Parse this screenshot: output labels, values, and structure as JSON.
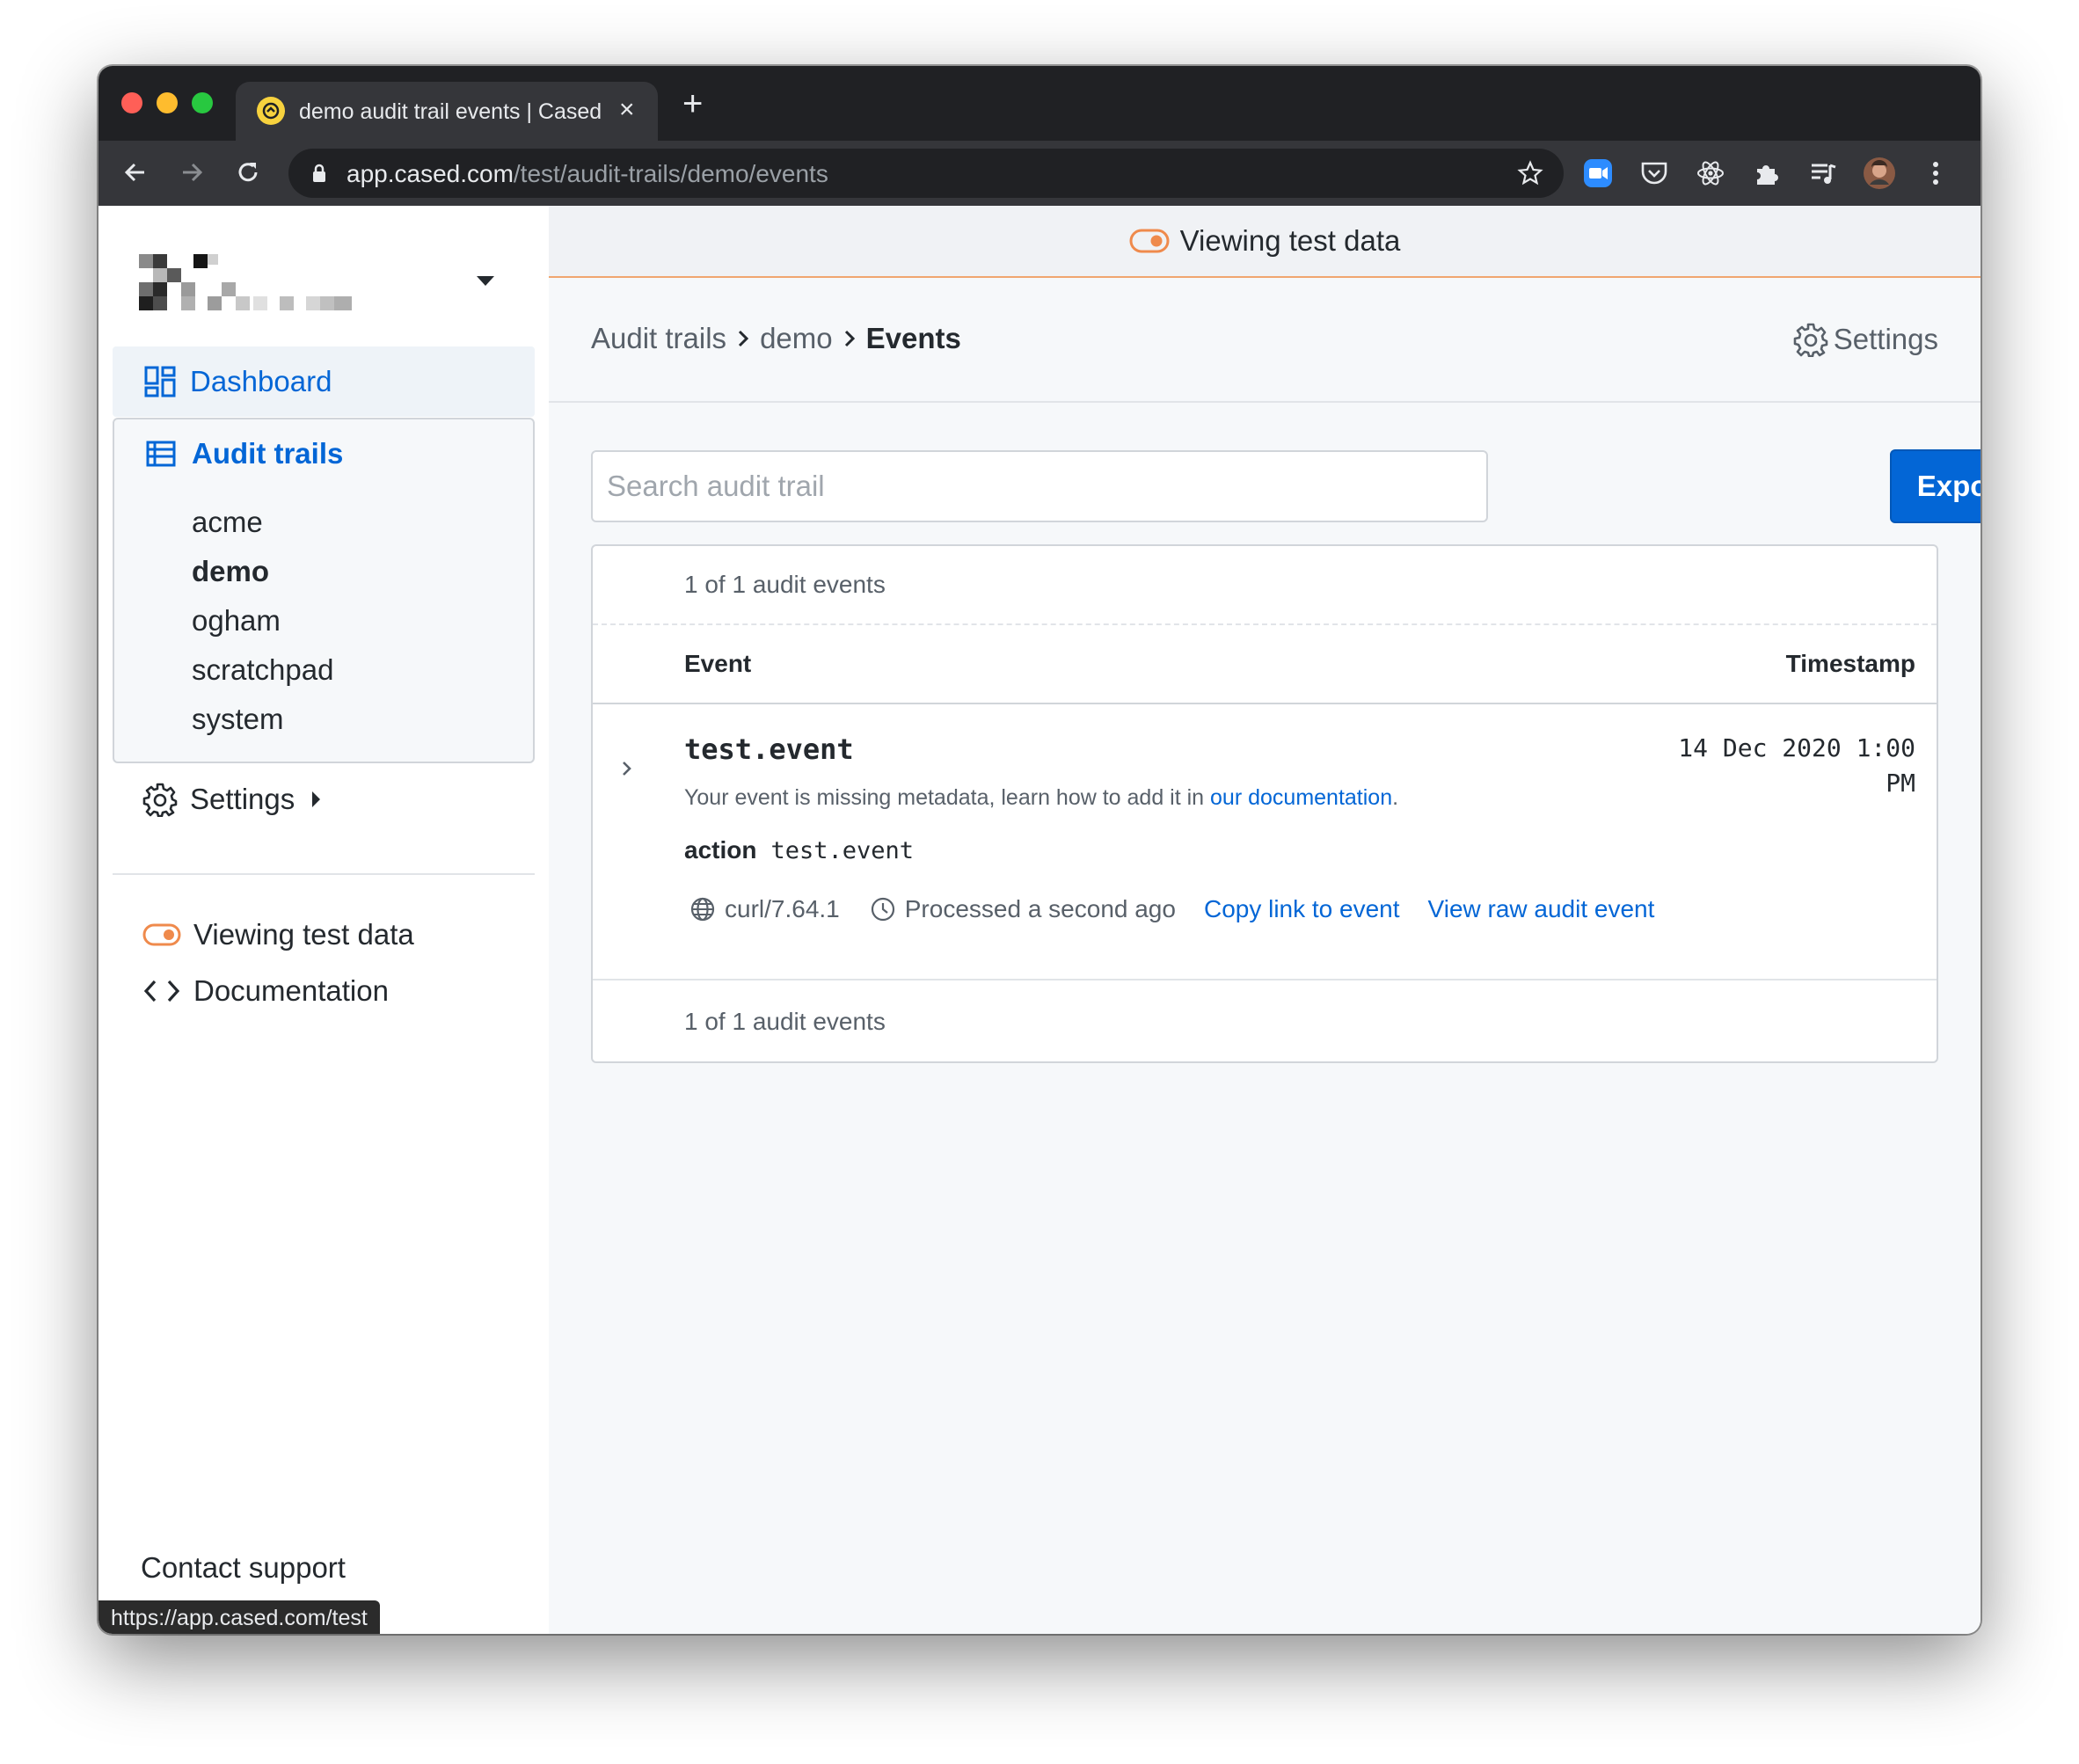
{
  "browser": {
    "tab_title": "demo audit trail events | Cased",
    "tab_close": "×",
    "new_tab": "+",
    "url_host": "app.cased.com",
    "url_path": "/test/audit-trails/demo/events",
    "status_url": "https://app.cased.com/test"
  },
  "sidebar": {
    "nav": {
      "dashboard": "Dashboard",
      "audit_trails": "Audit trails"
    },
    "trails": [
      "acme",
      "demo",
      "ogham",
      "scratchpad",
      "system"
    ],
    "active_trail": "demo",
    "settings": "Settings",
    "viewing_test_data": "Viewing test data",
    "documentation": "Documentation",
    "contact_support": "Contact support"
  },
  "banner": {
    "text": "Viewing test data"
  },
  "breadcrumb": {
    "items": [
      "Audit trails",
      "demo"
    ],
    "current": "Events"
  },
  "header": {
    "settings": "Settings"
  },
  "search": {
    "placeholder": "Search audit trail",
    "value": ""
  },
  "export_label": "Export",
  "table": {
    "count_text": "1 of 1 audit events",
    "columns": {
      "event": "Event",
      "timestamp": "Timestamp"
    },
    "rows": [
      {
        "name": "test.event",
        "timestamp": "14 Dec 2020 1:00 PM",
        "missing_text": "Your event is missing metadata, learn how to add it in ",
        "missing_link": "our documentation",
        "missing_end": ".",
        "action_key": "action",
        "action_value": "test.event",
        "agent": "curl/7.64.1",
        "processed": "Processed a second ago",
        "copy_link": "Copy link to event",
        "view_raw": "View raw audit event"
      }
    ]
  },
  "colors": {
    "accent": "#0366d6",
    "test_data_orange": "#ef8a4c",
    "chrome_dark": "#202124"
  }
}
